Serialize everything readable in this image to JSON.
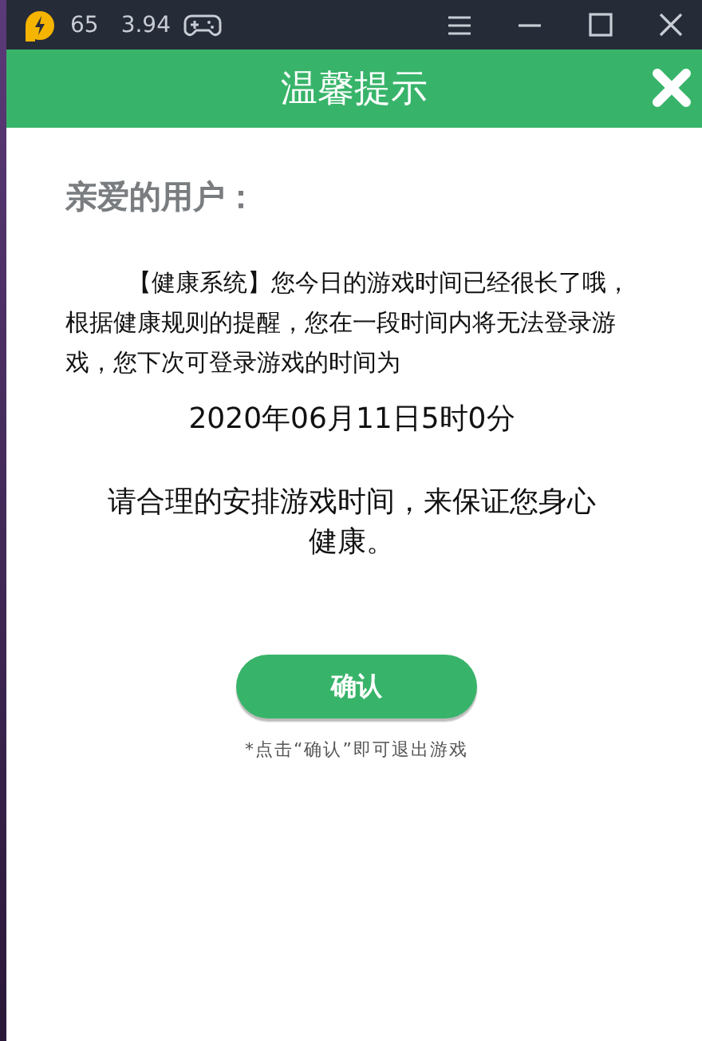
{
  "titlebar": {
    "fps": "65",
    "version": "3.94"
  },
  "dialog": {
    "title": "温馨提示",
    "greeting": "亲爱的用户：",
    "message": "【健康系统】您今日的游戏时间已经很长了哦，根据健康规则的提醒，您在一段时间内将无法登录游戏，您下次可登录游戏的时间为",
    "next_login": "2020年06月11日5时0分",
    "advice": "请合理的安排游戏时间，来保证您身心健康。",
    "confirm_button": "确认",
    "note": "*点击“确认”即可退出游戏"
  }
}
